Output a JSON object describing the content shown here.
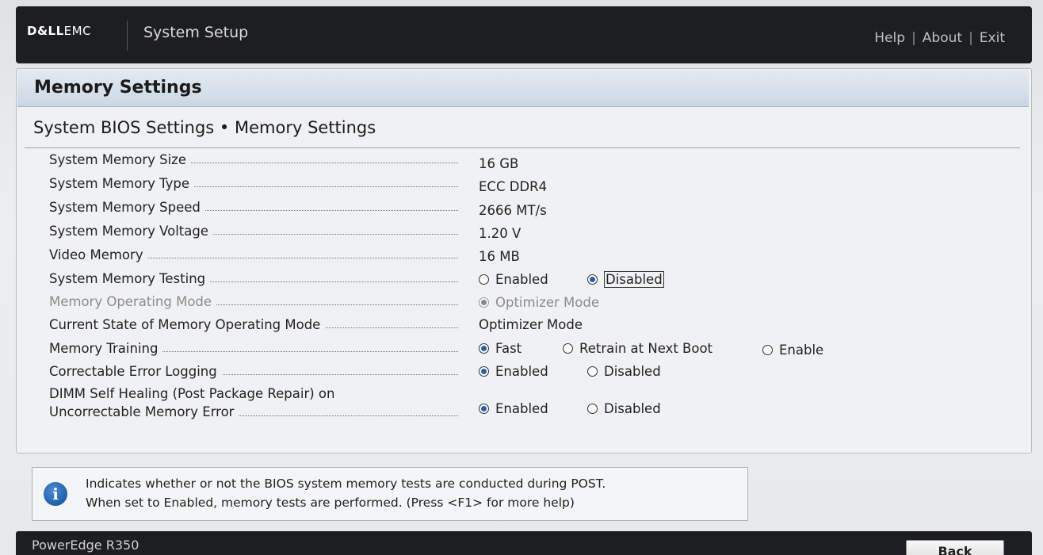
{
  "header": {
    "brand_left": "D&LL",
    "brand_right": "EMC",
    "app_title": "System Setup",
    "links": [
      "Help",
      "About",
      "Exit"
    ],
    "separator": "|"
  },
  "panel": {
    "title": "Memory Settings",
    "breadcrumb": "System BIOS Settings • Memory Settings"
  },
  "settings": [
    {
      "label": "System Memory Size",
      "value": "16 GB"
    },
    {
      "label": "System Memory Type",
      "value": "ECC DDR4"
    },
    {
      "label": "System Memory Speed",
      "value": "2666 MT/s"
    },
    {
      "label": "System Memory Voltage",
      "value": "1.20 V"
    },
    {
      "label": "Video Memory",
      "value": "16 MB"
    },
    {
      "label": "System Memory Testing",
      "options": [
        "Enabled",
        "Disabled"
      ],
      "selected": "Disabled"
    },
    {
      "label": "Memory Operating Mode",
      "options": [
        "Optimizer Mode"
      ],
      "selected": "Optimizer Mode",
      "disabled": true
    },
    {
      "label": "Current State of Memory Operating Mode",
      "value": "Optimizer Mode"
    },
    {
      "label": "Memory Training",
      "options": [
        "Fast",
        "Retrain at Next Boot",
        "Enable"
      ],
      "selected": "Fast"
    },
    {
      "label": "Correctable Error Logging",
      "options": [
        "Enabled",
        "Disabled"
      ],
      "selected": "Enabled"
    },
    {
      "label_line1": "DIMM Self Healing (Post Package Repair) on",
      "label_line2": "Uncorrectable Memory Error",
      "options": [
        "Enabled",
        "Disabled"
      ],
      "selected": "Enabled"
    }
  ],
  "info": {
    "icon": "info-icon",
    "line1": "Indicates whether or not the BIOS system memory tests are conducted during POST.",
    "line2": "When set to Enabled, memory tests are performed. (Press <F1> for more help)"
  },
  "footer": {
    "model": "PowerEdge R350",
    "back_label": "Back"
  },
  "colors": {
    "header_bg": "#1d1e22",
    "title_bar": "#d6e0ea",
    "radio_selected": "#2a5fa8"
  }
}
